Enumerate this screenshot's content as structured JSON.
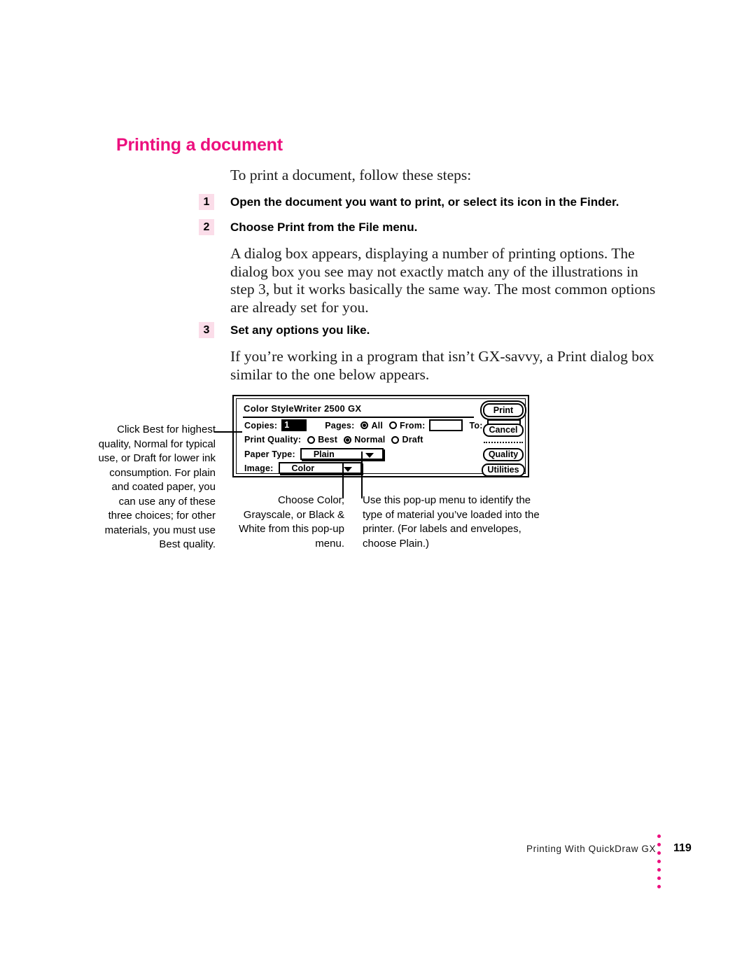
{
  "page": {
    "heading": "Printing a document",
    "intro": "To print a document, follow these steps:",
    "paragraph_dialog": "A dialog box appears, displaying a number of printing options. The dialog box you see may not exactly match any of the illustrations in step 3, but it works basically the same way. The most common options are already set for you.",
    "paragraph_gx": "If you’re working in a program that isn’t GX-savvy, a Print dialog box similar to the one below appears.",
    "heading_color": "#ec0f7e",
    "step_badge_color": "#fbdde9"
  },
  "steps": [
    {
      "number": "1",
      "text": "Open the document you want to print, or select its icon in the Finder."
    },
    {
      "number": "2",
      "text": "Choose Print from the File menu."
    },
    {
      "number": "3",
      "text": "Set any options you like."
    }
  ],
  "dialog": {
    "title": "Color StyleWriter 2500 GX",
    "copies_label": "Copies:",
    "copies_value": "1",
    "pages_label": "Pages:",
    "pages_all_label": "All",
    "pages_from_label": "From:",
    "pages_from_value": "",
    "pages_to_label": "To:",
    "pages_to_value": "",
    "print_quality_label": "Print Quality:",
    "quality_best_label": "Best",
    "quality_normal_label": "Normal",
    "quality_draft_label": "Draft",
    "quality_selected": "Normal",
    "paper_type_label": "Paper Type:",
    "paper_type_value": "Plain",
    "image_label": "Image:",
    "image_value": "Color",
    "buttons": {
      "print": "Print",
      "cancel": "Cancel",
      "quality": "Quality",
      "utilities": "Utilities"
    }
  },
  "callouts": {
    "print_quality": "Click Best for highest quality, Normal for typical use, or Draft for lower ink consumption. For plain and coated paper, you can use any of these three choices; for other materials, you must use Best quality.",
    "image_popup": "Choose Color, Grayscale, or Black & White from this pop-up menu.",
    "paper_popup": "Use this pop-up menu to identify the type of material you’ve loaded into the printer. (For labels and envelopes, choose Plain.)"
  },
  "footer": {
    "running_head": "Printing With QuickDraw GX",
    "page_number": "119",
    "dot_color": "#ec0f7e"
  }
}
